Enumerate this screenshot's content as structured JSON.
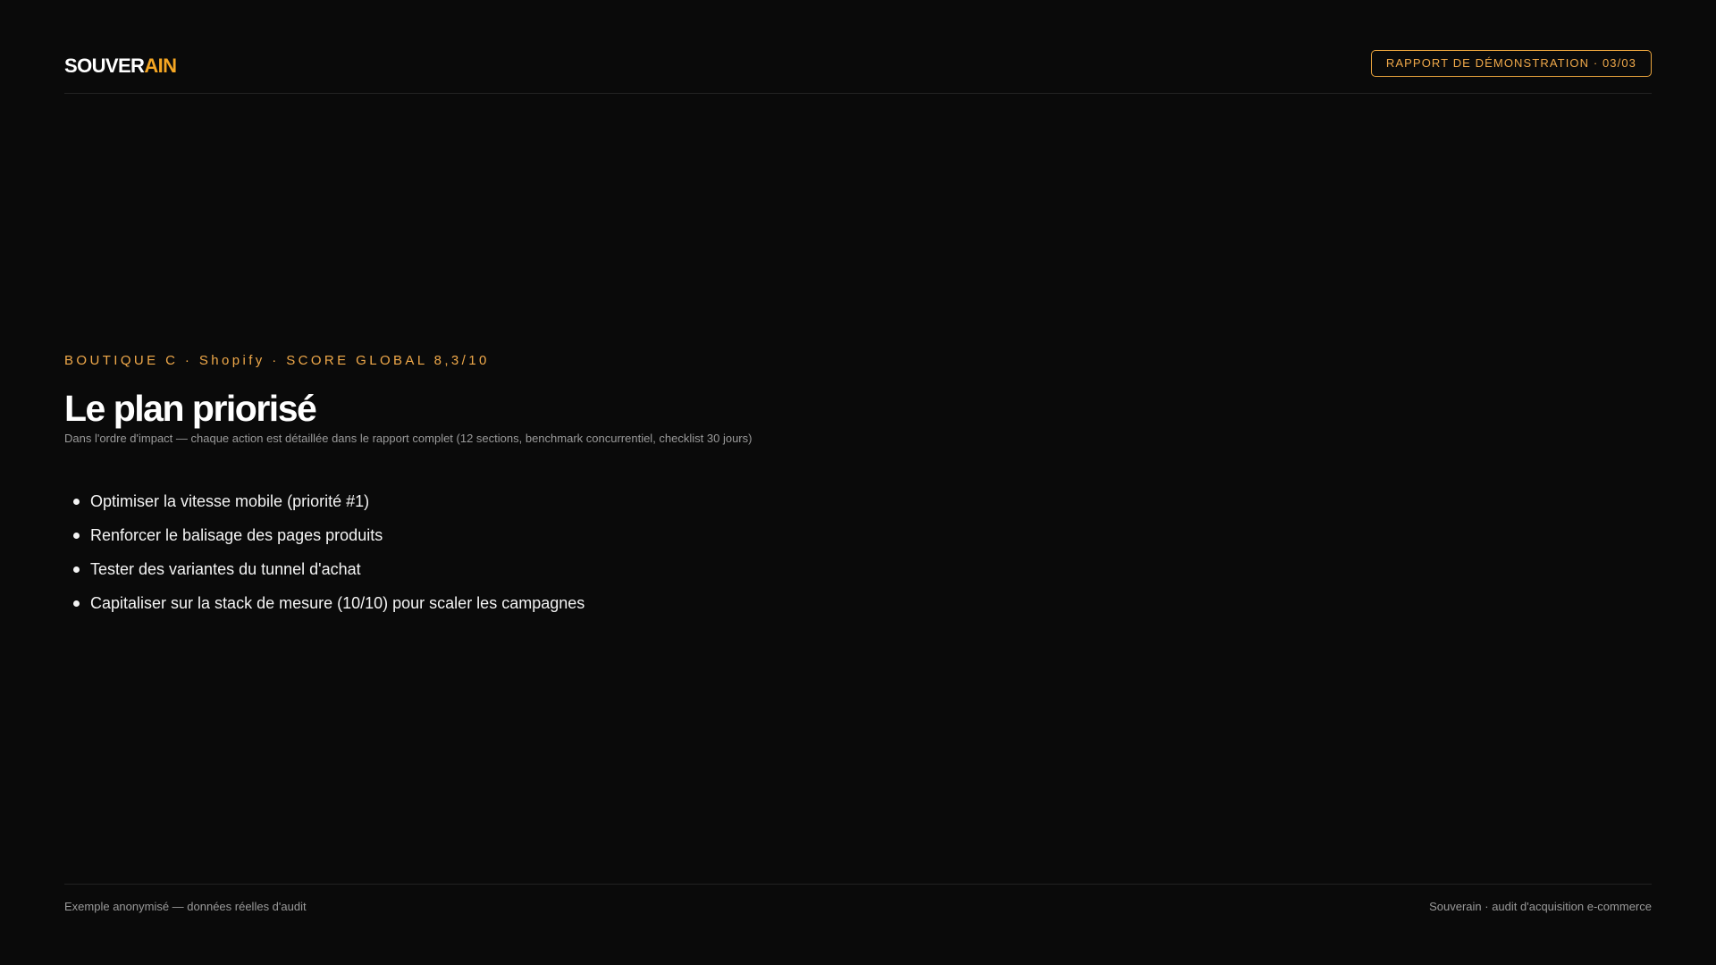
{
  "header": {
    "logo_part1": "SOUVER",
    "logo_part2": "AIN",
    "badge": "RAPPORT DE DÉMONSTRATION · 03/03"
  },
  "main": {
    "eyebrow": "BOUTIQUE C · Shopify · SCORE GLOBAL 8,3/10",
    "title": "Le plan priorisé",
    "subtitle": "Dans l'ordre d'impact — chaque action est détaillée dans le rapport complet (12 sections, benchmark concurrentiel, checklist 30 jours)",
    "actions": [
      "Optimiser la vitesse mobile (priorité #1)",
      "Renforcer le balisage des pages produits",
      "Tester des variantes du tunnel d'achat",
      "Capitaliser sur la stack de mesure (10/10) pour scaler les campagnes"
    ]
  },
  "footer": {
    "left": "Exemple anonymisé — données réelles d'audit",
    "right": "Souverain · audit d'acquisition e-commerce"
  },
  "colors": {
    "background": "#0a0a0a",
    "accent": "#f5a623",
    "text": "#ffffff",
    "muted": "#9a9a9a"
  }
}
